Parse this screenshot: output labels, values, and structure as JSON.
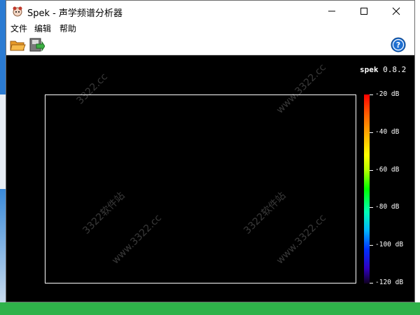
{
  "window": {
    "title": "Spek - 声学频谱分析器"
  },
  "menu": {
    "items": [
      "文件",
      "编辑",
      "帮助"
    ]
  },
  "toolbar": {
    "open_icon": "folder-open-icon",
    "save_icon": "save-icon",
    "help_icon": "help-icon"
  },
  "spectrogram": {
    "brand_name": "spek",
    "version": "0.8.2",
    "db_ticks": [
      "-20 dB",
      "-40 dB",
      "-60 dB",
      "-80 dB",
      "-100 dB",
      "-120 dB"
    ]
  },
  "watermarks": [
    "3322.cc",
    "www.3322.cc",
    "3322软件站",
    "www.3322.cc",
    "3322软件站",
    "www.3322.cc"
  ],
  "colors": {
    "plot_background": "#000000",
    "frame": "#ffffff"
  }
}
